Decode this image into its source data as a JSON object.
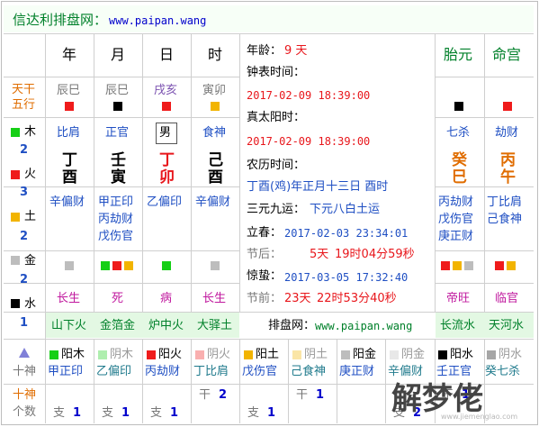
{
  "header": {
    "site_label": "信达利排盘网：",
    "site_url": "www.paipan.wang"
  },
  "pillars": {
    "headers": [
      "年",
      "月",
      "日",
      "时"
    ],
    "side_labels": [
      "天干",
      "五行"
    ],
    "ganzhi_top": [
      "辰巳",
      "辰巳",
      "戌亥",
      "寅卯"
    ],
    "ten_gods_top": [
      "比肩",
      "正官",
      "男",
      "食神"
    ],
    "stems": [
      "丁",
      "壬",
      "丁",
      "己"
    ],
    "branches": [
      "酉",
      "寅",
      "卯",
      "酉"
    ]
  },
  "five_elements": {
    "wood": {
      "name": "木",
      "count": "2"
    },
    "fire": {
      "name": "火",
      "count": "3"
    },
    "earth": {
      "name": "土",
      "count": "2"
    },
    "metal": {
      "name": "金",
      "count": "2"
    },
    "water": {
      "name": "水",
      "count": "1"
    }
  },
  "hidden_stems": {
    "col1": [
      "辛偏财"
    ],
    "col2": [
      "甲正印",
      "丙劫财",
      "戊伤官"
    ],
    "col3": [
      "乙偏印"
    ],
    "col4": [
      "辛偏财"
    ]
  },
  "twelve_stages": [
    "长生",
    "死",
    "病",
    "长生"
  ],
  "nayin": [
    "山下火",
    "金箔金",
    "炉中火",
    "大驿土"
  ],
  "info_panel": {
    "age_label": "年龄：",
    "age_value": "9 天",
    "clock_time_label": "钟表时间：",
    "clock_time_value": "2017-02-09 18:39:00",
    "solar_time_label": "真太阳时：",
    "solar_time_value": "2017-02-09 18:39:00",
    "lunar_label": "农历时间：",
    "lunar_value": "丁酉(鸡)年正月十三日 酉时",
    "yuan_yun_label": "三元九运：",
    "yuan_yun_value": "下元八白土运",
    "lichun_label": "立春：",
    "lichun_value": "2017-02-03 23:34:01",
    "lichun_after_label": "节后：",
    "lichun_after_value_day": "5天",
    "lichun_after_value_time": "19时04分59秒",
    "jingzhe_label": "惊蛰：",
    "jingzhe_value": "2017-03-05 17:32:40",
    "jingzhe_before_label": "节前：",
    "jingzhe_before_value_day": "23天",
    "jingzhe_before_value_time": "22时53分40秒",
    "site_label": "排盘网：",
    "site_url": "www.paipan.wang"
  },
  "right_table": {
    "headers": [
      "胎元",
      "命宫"
    ],
    "ten_gods": [
      "七杀",
      "劫财"
    ],
    "stems": [
      "癸",
      "丙"
    ],
    "branches": [
      "巳",
      "午"
    ],
    "hidden": {
      "left": [
        "丙劫财",
        "戊伤官",
        "庚正财"
      ],
      "right": [
        "丁比肩",
        "己食神"
      ]
    },
    "stages": [
      "帝旺",
      "临官"
    ],
    "nayin": [
      "长流水",
      "天河水"
    ]
  },
  "bottom": {
    "shishen_label": "十神",
    "count_label": "十神",
    "count_sublabel": "个数",
    "triangle_icon": "triangle-up-icon",
    "cols": [
      {
        "a": "阳木",
        "b": "甲正印",
        "top": "",
        "bot_label": "支",
        "bot": "1"
      },
      {
        "a": "阴木",
        "b": "乙偏印",
        "top": "",
        "bot_label": "支",
        "bot": "1"
      },
      {
        "a": "阳火",
        "b": "丙劫财",
        "top": "",
        "bot_label": "支",
        "bot": "1"
      },
      {
        "a": "阴火",
        "b": "丁比肩",
        "top_label": "干",
        "top": "2",
        "bot_label": "",
        "bot": ""
      },
      {
        "a": "阳土",
        "b": "戊伤官",
        "top": "",
        "bot_label": "支",
        "bot": "1"
      },
      {
        "a": "阴土",
        "b": "己食神",
        "top_label": "干",
        "top": "1",
        "bot_label": "",
        "bot": ""
      },
      {
        "a": "阳金",
        "b": "庚正财",
        "top": "",
        "bot_label": "",
        "bot": ""
      },
      {
        "a": "阴金",
        "b": "辛偏财",
        "top": "",
        "bot_label": "支",
        "bot": "2"
      },
      {
        "a": "阳水",
        "b": "壬正官",
        "top_label": "干",
        "top": "1",
        "bot_label": "",
        "bot": ""
      },
      {
        "a": "阴水",
        "b": "癸七杀",
        "top": "",
        "bot_label": "",
        "bot": ""
      }
    ]
  },
  "watermark": {
    "text": "解梦佬",
    "url": "www.jiemenglao.com"
  },
  "colors": {
    "red": "#e8161b",
    "blue": "#1f4fc3",
    "green": "#00802a",
    "orange": "#e06d00",
    "purple": "#7b52b0"
  }
}
